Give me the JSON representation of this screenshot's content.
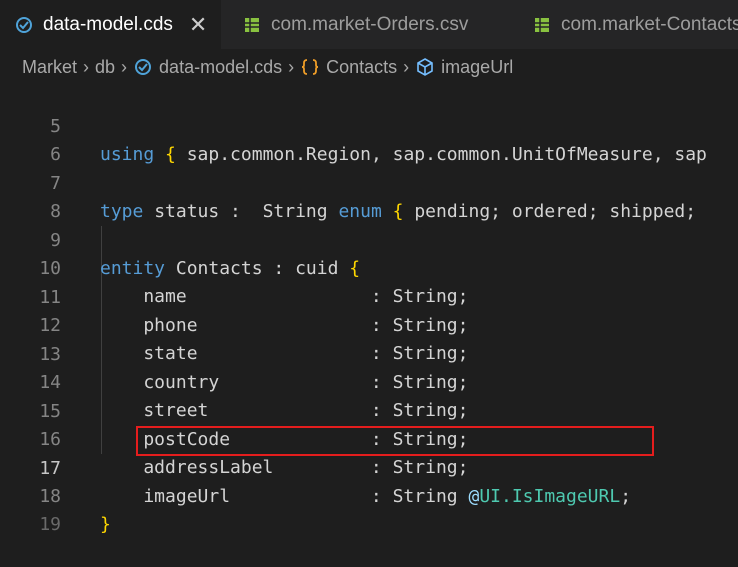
{
  "tabs": [
    {
      "label": "data-model.cds",
      "icon": "cds-file-icon",
      "active": true
    },
    {
      "label": "com.market-Orders.csv",
      "icon": "csv-table-icon",
      "active": false
    },
    {
      "label": "com.market-Contacts",
      "icon": "csv-table-icon",
      "active": false
    }
  ],
  "tab_close": "✕",
  "breadcrumb": {
    "items": [
      "Market",
      "db",
      "data-model.cds",
      "Contacts",
      "imageUrl"
    ],
    "separator": "›"
  },
  "code": {
    "lines": [
      {
        "n": "5",
        "text": "using { sap.common.Region, sap.common.UnitOfMeasure, sap"
      },
      {
        "n": "6",
        "text": ""
      },
      {
        "n": "7",
        "text": "type status :  String enum { pending; ordered; shipped;"
      },
      {
        "n": "8",
        "text": ""
      },
      {
        "n": "9",
        "text": "entity Contacts : cuid {"
      },
      {
        "n": "10",
        "text": "    name                 : String;"
      },
      {
        "n": "11",
        "text": "    phone                : String;"
      },
      {
        "n": "12",
        "text": "    state                : String;"
      },
      {
        "n": "13",
        "text": "    country              : String;"
      },
      {
        "n": "14",
        "text": "    street               : String;"
      },
      {
        "n": "15",
        "text": "    postCode             : String;"
      },
      {
        "n": "16",
        "text": "    addressLabel         : String;"
      },
      {
        "n": "17",
        "text": "    imageUrl             : String @UI.IsImageURL;"
      },
      {
        "n": "18",
        "text": "}"
      }
    ],
    "current_line": "17"
  },
  "colors": {
    "background": "#1e1e1e",
    "keyword": "#569cd6",
    "bracket": "#ffd700",
    "annotation": "#4ec9b0",
    "highlight_box": "#e51d1d"
  }
}
